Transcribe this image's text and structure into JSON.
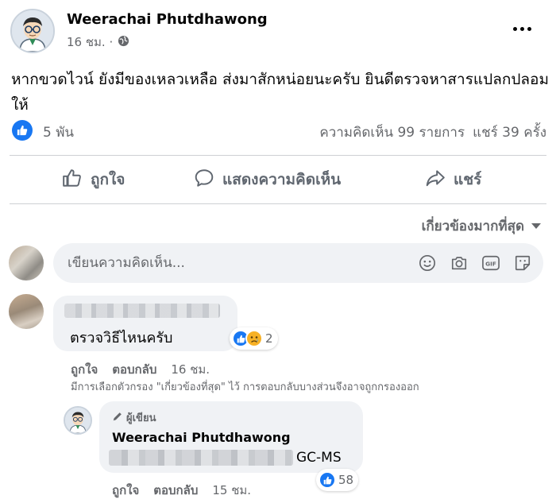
{
  "post": {
    "author": "Weerachai Phutdhawong",
    "time": "16 ชม. ·",
    "text": "หากขวดไวน์ ยังมีของเหลวเหลือ ส่งมาสักหน่อยนะครับ ยินดีตรวจหาสารแปลกปลอมให้"
  },
  "stats": {
    "reactions": "5 พัน",
    "comments": "ความคิดเห็น 99 รายการ",
    "shares": "แชร์ 39 ครั้ง"
  },
  "actions": {
    "like": "ถูกใจ",
    "comment": "แสดงความคิดเห็น",
    "share": "แชร์"
  },
  "sort": {
    "label": "เกี่ยวข้องมากที่สุด"
  },
  "comment_input": {
    "placeholder": "เขียนความคิดเห็น..."
  },
  "comments": [
    {
      "text": "ตรวจวิธีไหนครับ",
      "reaction_count": "2",
      "like_label": "ถูกใจ",
      "reply_label": "ตอบกลับ",
      "time": "16 ชม."
    }
  ],
  "filter_note": "มีการเลือกตัวกรอง \"เกี่ยวข้องที่สุด\" ไว้ การตอบกลับบางส่วนจึงอาจถูกกรองออก",
  "reply": {
    "badge": "ผู้เขียน",
    "author": "Weerachai Phutdhawong",
    "text_visible": "GC-MS",
    "reaction_count": "58",
    "like_label": "ถูกใจ",
    "reply_label": "ตอบกลับ",
    "time": "15 ชม."
  },
  "colors": {
    "accent": "#1877f2",
    "muted_text": "#65676b",
    "bubble_bg": "#f0f2f5",
    "divider": "#ced0d4"
  },
  "icons": [
    "globe-icon",
    "more-icon",
    "like-icon",
    "comment-icon",
    "share-icon",
    "chevron-down-icon",
    "emoji-icon",
    "camera-icon",
    "gif-icon",
    "sticker-icon",
    "pen-icon"
  ]
}
